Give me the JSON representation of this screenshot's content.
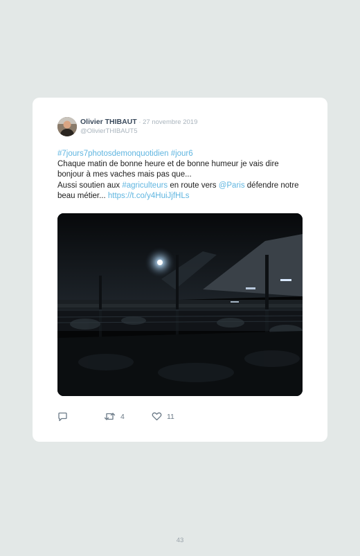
{
  "tweet": {
    "author_name": "Olivier THIBAUT",
    "separator": " · ",
    "date": "27 novembre 2019",
    "handle": "@OlivierTHIBAUT5",
    "hashtag_1": "#7jours7photosdemonquotidien",
    "hashtag_2": "#jour6",
    "line_1": "Chaque matin de bonne heure et de bonne humeur je vais dire bonjour à mes vaches mais pas que...",
    "line_2_start": "Aussi soutien aux ",
    "hashtag_3": "#agriculteurs",
    "line_2_mid": " en route vers ",
    "mention": "@Paris",
    "line_3_start": " défendre notre beau métier... ",
    "short_link": "https://t.co/y4HuiJjfHLs",
    "photo_alt": "cowshed at night",
    "actions": {
      "reply_icon": "reply-icon",
      "retweet_icon": "retweet-icon",
      "retweet_count": "4",
      "like_icon": "heart-icon",
      "like_count": "11"
    }
  },
  "page": {
    "number": "43"
  },
  "colors": {
    "background": "#e3e8e7",
    "card": "#ffffff",
    "link": "#5fb5e0",
    "muted": "#a9b4bd"
  }
}
